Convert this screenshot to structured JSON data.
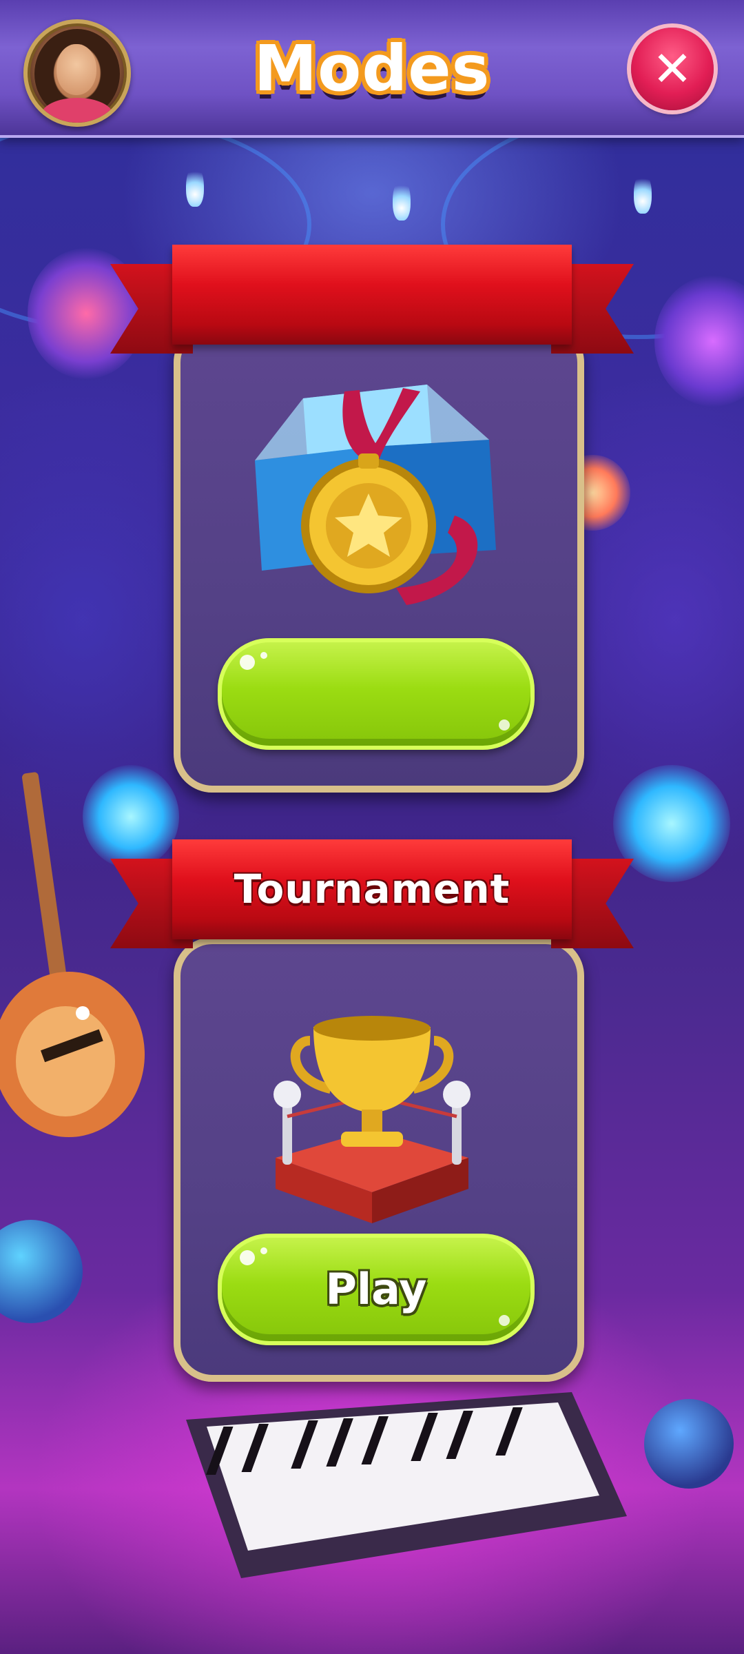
{
  "header": {
    "title": "Modes",
    "avatar_icon": "player-avatar",
    "close_icon": "close-icon",
    "close_glyph": "✕"
  },
  "modes": [
    {
      "name": "",
      "icon": "medal-icon",
      "button_label": ""
    },
    {
      "name": "Tournament",
      "icon": "trophy-icon",
      "button_label": "Play"
    }
  ],
  "colors": {
    "ribbon": "#e0101c",
    "button": "#9bdc12",
    "card": "#544186",
    "card_border": "#d9c08a",
    "close": "#e21e55",
    "title_outline": "#f39a1e"
  }
}
